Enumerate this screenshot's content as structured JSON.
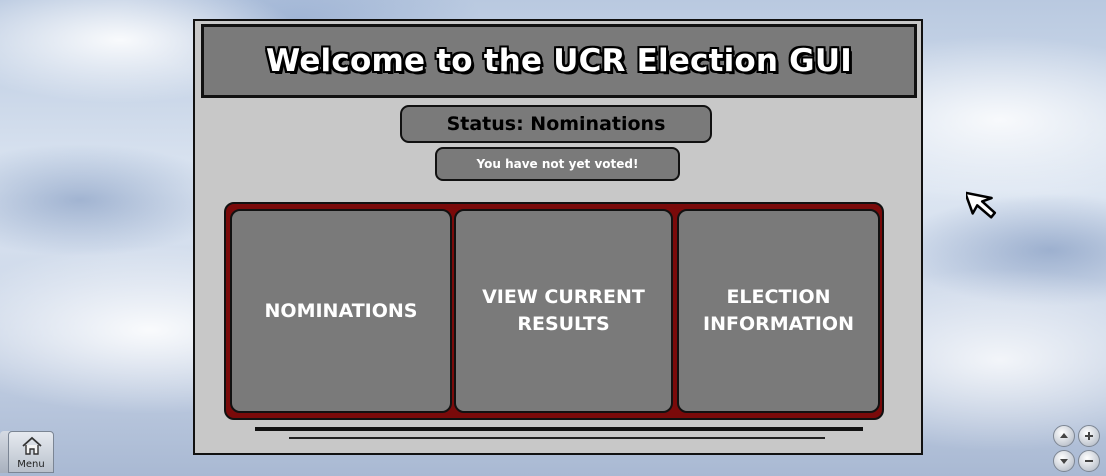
{
  "window": {
    "title": "Welcome to the UCR Election GUI"
  },
  "status": {
    "label": "Status: Nominations",
    "vote_message": "You have not yet voted!"
  },
  "options": [
    {
      "label": "NOMINATIONS"
    },
    {
      "label": "VIEW CURRENT\nRESULTS"
    },
    {
      "label": "ELECTION\nINFORMATION"
    }
  ],
  "menu": {
    "label": "Menu",
    "icon": "home-icon"
  },
  "zoom_controls": {
    "icons": [
      "arrow-up-icon",
      "plus-icon",
      "arrow-down-icon",
      "minus-icon"
    ]
  },
  "colors": {
    "panel_bg": "#c8c8c8",
    "button_gray": "#7a7a7a",
    "frame_red": "#7a0a0a"
  }
}
